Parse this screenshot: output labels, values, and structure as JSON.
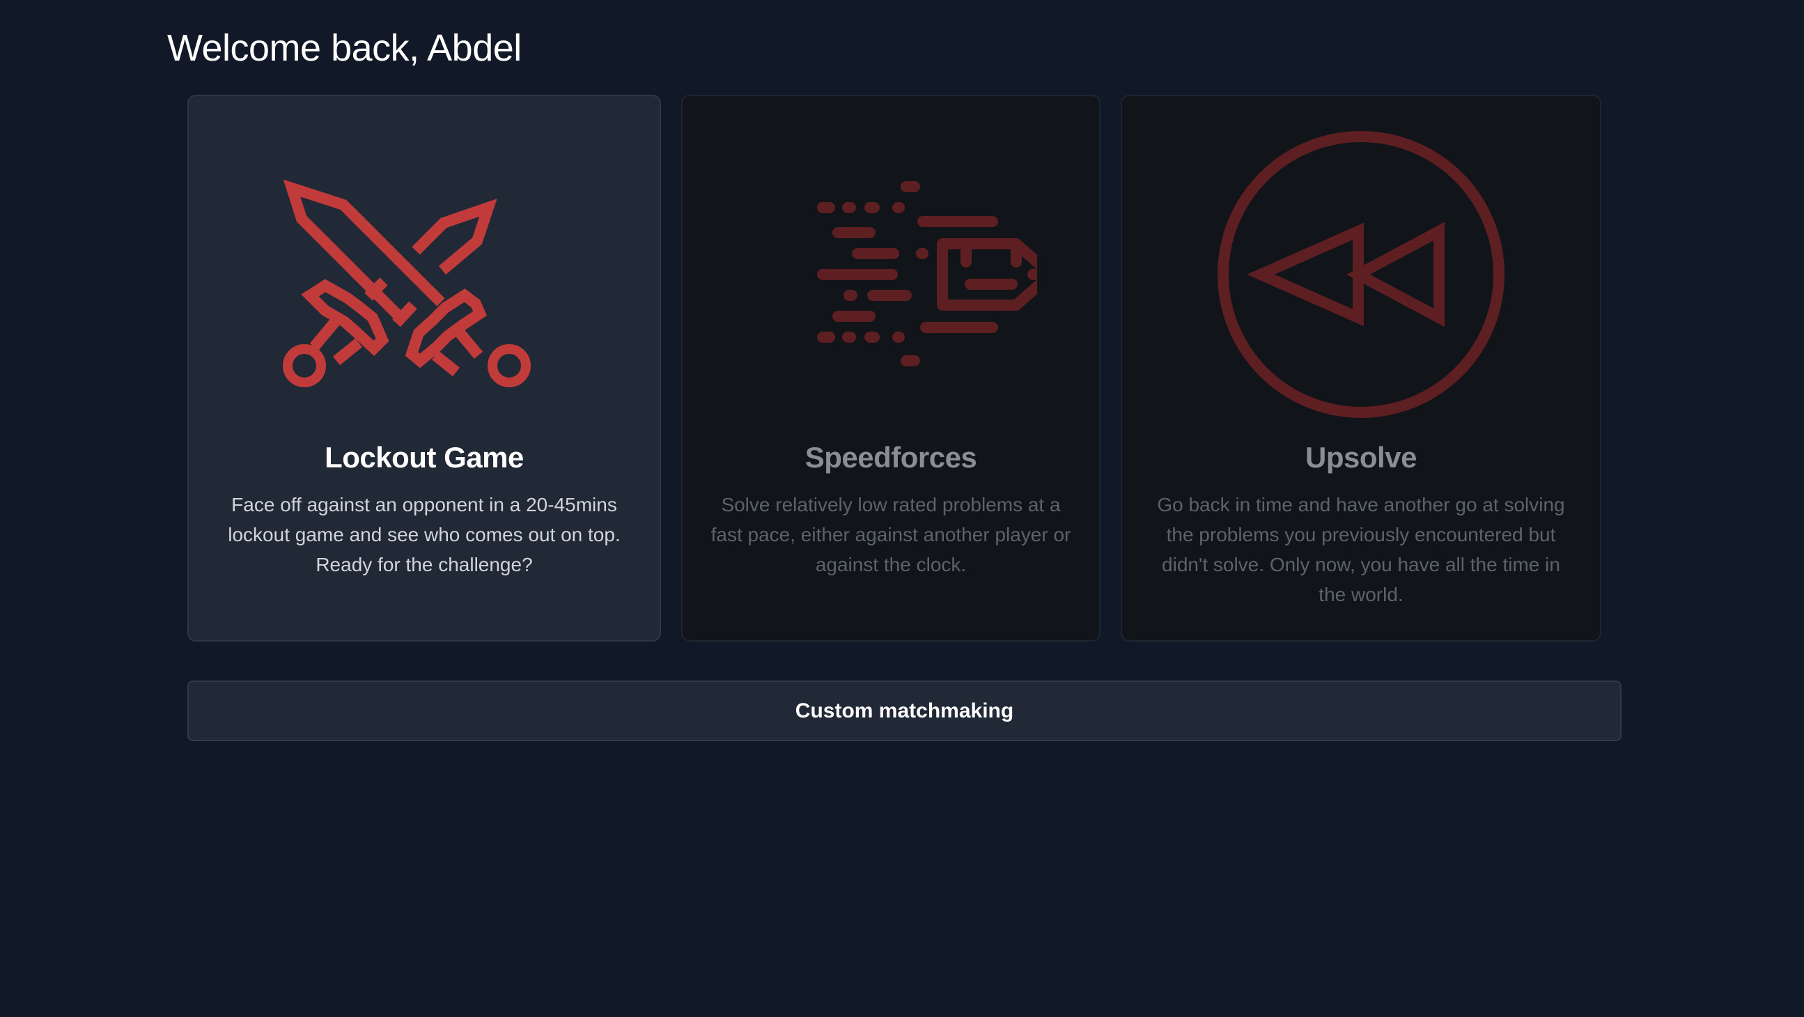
{
  "header": {
    "welcome_text": "Welcome back, Abdel"
  },
  "colors": {
    "background": "#111827",
    "card_active_bg": "#212836",
    "card_inactive_bg": "#111419",
    "accent_red": "#c23b3b",
    "accent_red_dim": "#5e1f22"
  },
  "modes": [
    {
      "id": "lockout",
      "icon": "crossed-swords-icon",
      "title": "Lockout Game",
      "description": "Face off against an opponent in a 20-45mins lockout game and see who comes out on top. Ready for the challenge?",
      "selected": true
    },
    {
      "id": "speedforces",
      "icon": "speeding-bullet-icon",
      "title": "Speedforces",
      "description": "Solve relatively low rated problems at a fast pace, either against another player or against the clock.",
      "selected": false
    },
    {
      "id": "upsolve",
      "icon": "rewind-circle-icon",
      "title": "Upsolve",
      "description": "Go back in time and have another go at solving the problems you previously encountered but didn't solve. Only now, you have all the time in the world.",
      "selected": false
    }
  ],
  "custom_matchmaking": {
    "label": "Custom matchmaking"
  }
}
